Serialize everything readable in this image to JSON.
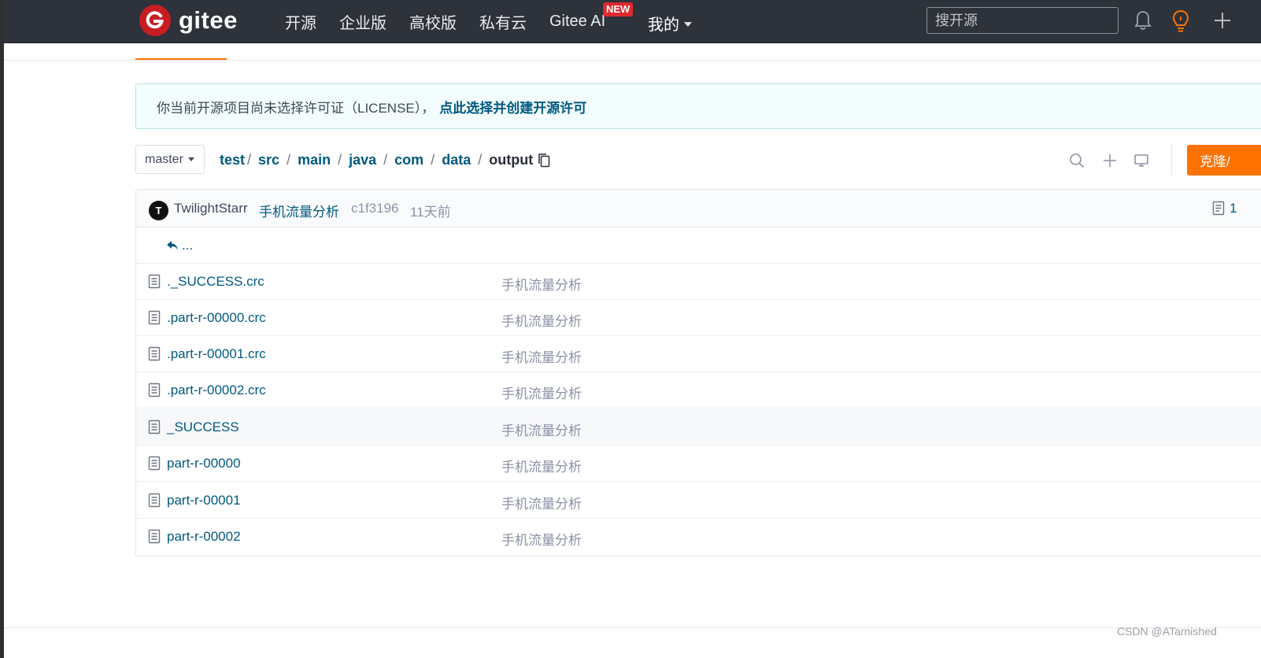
{
  "navbar": {
    "logo_text": "gitee",
    "links": [
      "开源",
      "企业版",
      "高校版",
      "私有云",
      "Gitee AI"
    ],
    "new_badge": "NEW",
    "mine": "我的",
    "search_placeholder": "搜开源"
  },
  "license": {
    "text": "你当前开源项目尚未选择许可证（LICENSE），",
    "link": "点此选择并创建开源许可"
  },
  "branch": "master",
  "breadcrumb": [
    "test",
    "src",
    "main",
    "java",
    "com",
    "data",
    "output"
  ],
  "clone_label": "克隆/",
  "commit": {
    "avatar_letter": "T",
    "author": "TwilightStarr",
    "message": "手机流量分析",
    "sha": "c1f3196",
    "time": "11天前",
    "count": "1"
  },
  "parent_dir": "...",
  "files": [
    {
      "name": "._SUCCESS.crc",
      "message": "手机流量分析"
    },
    {
      "name": ".part-r-00000.crc",
      "message": "手机流量分析"
    },
    {
      "name": ".part-r-00001.crc",
      "message": "手机流量分析"
    },
    {
      "name": ".part-r-00002.crc",
      "message": "手机流量分析"
    },
    {
      "name": "_SUCCESS",
      "message": "手机流量分析"
    },
    {
      "name": "part-r-00000",
      "message": "手机流量分析"
    },
    {
      "name": "part-r-00001",
      "message": "手机流量分析"
    },
    {
      "name": "part-r-00002",
      "message": "手机流量分析"
    }
  ],
  "watermark": "CSDN @ATarnished",
  "colors": {
    "accent": "#fe7300",
    "link": "#005980",
    "navbar": "#2d323b",
    "logo": "#c71d23"
  }
}
